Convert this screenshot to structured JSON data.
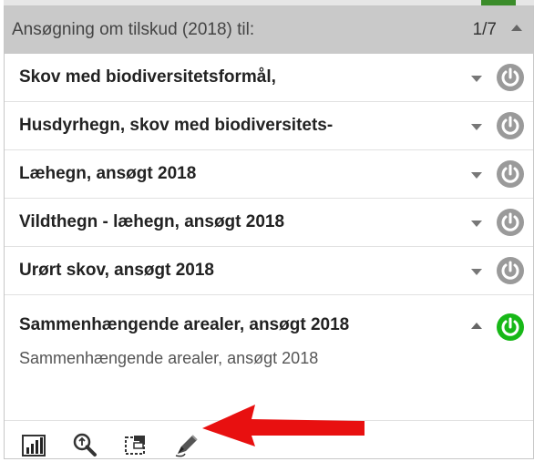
{
  "panel": {
    "title": "Ansøgning om tilskud (2018) til:",
    "counter": "1/7"
  },
  "rows": [
    {
      "label": "Skov med biodiversitetsformål,"
    },
    {
      "label": "Husdyrhegn, skov med biodiversitets-"
    },
    {
      "label": "Læhegn, ansøgt 2018"
    },
    {
      "label": "Vildthegn - læhegn, ansøgt 2018"
    },
    {
      "label": "Urørt skov, ansøgt 2018"
    }
  ],
  "expanded": {
    "title": "Sammenhængende arealer, ansøgt 2018",
    "description": "Sammenhængende arealer, ansøgt 2018"
  },
  "colors": {
    "power_off": "#9a9a9a",
    "power_on": "#18b818",
    "header_bg": "#c9c9c9",
    "annotation_arrow": "#e81010"
  },
  "toolbar": {
    "icons": [
      "bar-chart-icon",
      "zoom-to-icon",
      "select-area-icon",
      "edit-pencil-icon"
    ]
  }
}
